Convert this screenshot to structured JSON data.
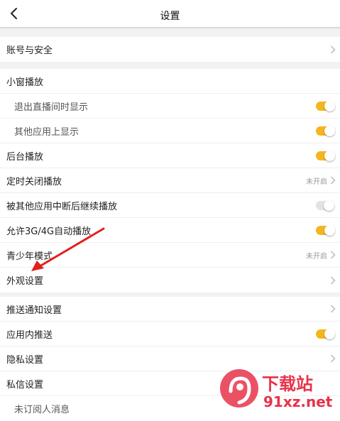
{
  "header": {
    "title": "设置",
    "back_icon": "chevron-left-icon"
  },
  "sections": [
    {
      "items": [
        {
          "label": "账号与安全",
          "control": "chevron"
        }
      ]
    },
    {
      "items": [
        {
          "label": "小窗播放",
          "control": "none"
        },
        {
          "label": "退出直播间时显示",
          "control": "toggle",
          "on": true,
          "sub": true
        },
        {
          "label": "其他应用上显示",
          "control": "toggle",
          "on": true,
          "sub": true
        },
        {
          "label": "后台播放",
          "control": "toggle",
          "on": true
        },
        {
          "label": "定时关闭播放",
          "control": "chevron",
          "status": "未开启"
        },
        {
          "label": "被其他应用中断后继续播放",
          "control": "toggle",
          "on": false
        },
        {
          "label": "允许3G/4G自动播放",
          "control": "toggle",
          "on": true
        },
        {
          "label": "青少年模式",
          "control": "chevron",
          "status": "未开启"
        },
        {
          "label": "外观设置",
          "control": "chevron"
        }
      ]
    },
    {
      "items": [
        {
          "label": "推送通知设置",
          "control": "chevron"
        },
        {
          "label": "应用内推送",
          "control": "toggle",
          "on": true
        },
        {
          "label": "隐私设置",
          "control": "chevron"
        },
        {
          "label": "私信设置",
          "control": "none"
        },
        {
          "label": "未订阅人消息",
          "control": "none",
          "sub": true
        }
      ]
    }
  ],
  "watermark": {
    "logo_text": "下载站",
    "url_text": "91xz.net"
  },
  "colors": {
    "accent": "#f5b51f",
    "annotation": "#e02020",
    "watermark": "#e8324a"
  }
}
